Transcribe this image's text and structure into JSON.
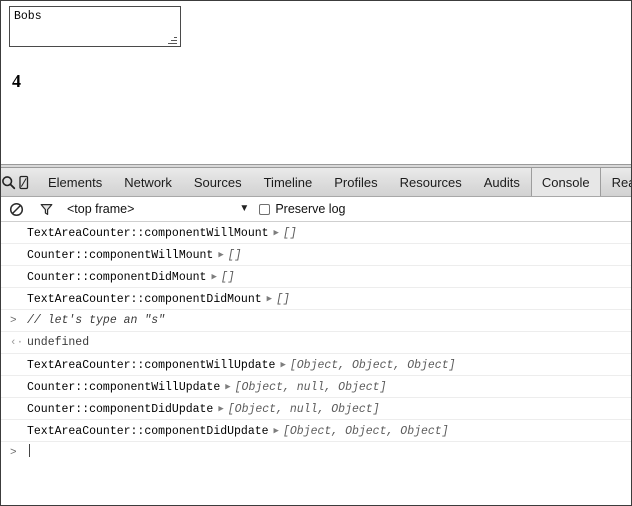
{
  "page": {
    "textarea": {
      "value": "Bobs",
      "placeholder": ""
    },
    "counter_display": "4"
  },
  "devtools": {
    "tabbar": {
      "search_icon": "search-icon",
      "device_icon": "device-toggle-icon",
      "tabs": [
        {
          "label": "Elements",
          "selected": false
        },
        {
          "label": "Network",
          "selected": false
        },
        {
          "label": "Sources",
          "selected": false
        },
        {
          "label": "Timeline",
          "selected": false
        },
        {
          "label": "Profiles",
          "selected": false
        },
        {
          "label": "Resources",
          "selected": false
        },
        {
          "label": "Audits",
          "selected": false
        },
        {
          "label": "Console",
          "selected": true
        },
        {
          "label": "React",
          "selected": false
        }
      ]
    },
    "console_toolbar": {
      "clear_icon": "clear-console-icon",
      "filter_icon": "filter-icon",
      "frame_selector": "<top frame>",
      "frame_chevron": "▼",
      "preserve_log_label": "Preserve log",
      "preserve_log_checked": false
    },
    "console_messages": [
      {
        "marker": "",
        "text": "TextAreaCounter::componentWillMount",
        "disclosure": "▶",
        "value": "[]",
        "kind": "log"
      },
      {
        "marker": "",
        "text": "Counter::componentWillMount",
        "disclosure": "▶",
        "value": "[]",
        "kind": "log"
      },
      {
        "marker": "",
        "text": "Counter::componentDidMount",
        "disclosure": "▶",
        "value": "[]",
        "kind": "log"
      },
      {
        "marker": "",
        "text": "TextAreaCounter::componentDidMount",
        "disclosure": "▶",
        "value": "[]",
        "kind": "log"
      },
      {
        "marker": ">",
        "text": "// let's type an \"s\"",
        "disclosure": "",
        "value": "",
        "kind": "input"
      },
      {
        "marker": "‹·",
        "text": "undefined",
        "disclosure": "",
        "value": "",
        "kind": "result"
      },
      {
        "marker": "",
        "text": "TextAreaCounter::componentWillUpdate",
        "disclosure": "▶",
        "value": "[Object, Object, Object]",
        "kind": "log"
      },
      {
        "marker": "",
        "text": "Counter::componentWillUpdate",
        "disclosure": "▶",
        "value": "[Object, null, Object]",
        "kind": "log"
      },
      {
        "marker": "",
        "text": "Counter::componentDidUpdate",
        "disclosure": "▶",
        "value": "[Object, null, Object]",
        "kind": "log"
      },
      {
        "marker": "",
        "text": "TextAreaCounter::componentDidUpdate",
        "disclosure": "▶",
        "value": "[Object, Object, Object]",
        "kind": "log"
      }
    ],
    "prompt": {
      "marker": ">",
      "value": ""
    }
  },
  "colors": {
    "tabbar_bg": "#dcdcdc",
    "tab_selected_bg": "#e7e7e7",
    "row_separator": "#ededed",
    "value_text": "#5c5c5c",
    "frame_border": "#3c3c3c"
  }
}
